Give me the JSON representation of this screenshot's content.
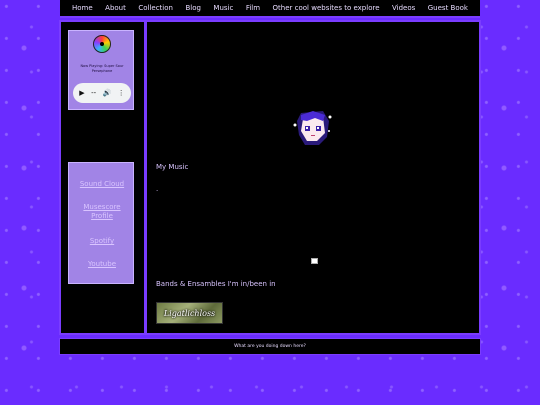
{
  "nav": {
    "items": [
      {
        "label": "Home"
      },
      {
        "label": "About"
      },
      {
        "label": "Collection"
      },
      {
        "label": "Blog"
      },
      {
        "label": "Music"
      },
      {
        "label": "Film"
      },
      {
        "label": "Other cool websites to explore"
      },
      {
        "label": "Videos"
      },
      {
        "label": "Guest Book"
      }
    ]
  },
  "sidebar": {
    "now_playing": "Now Playing: Super Sour\nPersephone",
    "player": {
      "play_icon": "▶",
      "time": "--",
      "volume_icon": "🔊",
      "more_icon": "⋮"
    },
    "links": [
      {
        "label": "Sound Cloud"
      },
      {
        "label": "Musescore Profile"
      },
      {
        "label": "Spotify"
      },
      {
        "label": "Youtube"
      }
    ]
  },
  "main": {
    "my_music": "My Music",
    "dot": ".",
    "bands_title": "Bands & Ensambles I'm in/been in",
    "band_image_text": "Ligatlichloss"
  },
  "footer": {
    "text": "What are you doing down here?"
  },
  "colors": {
    "accent": "#7a3cff",
    "panel": "#a184e6",
    "background": "#6a2cff"
  }
}
